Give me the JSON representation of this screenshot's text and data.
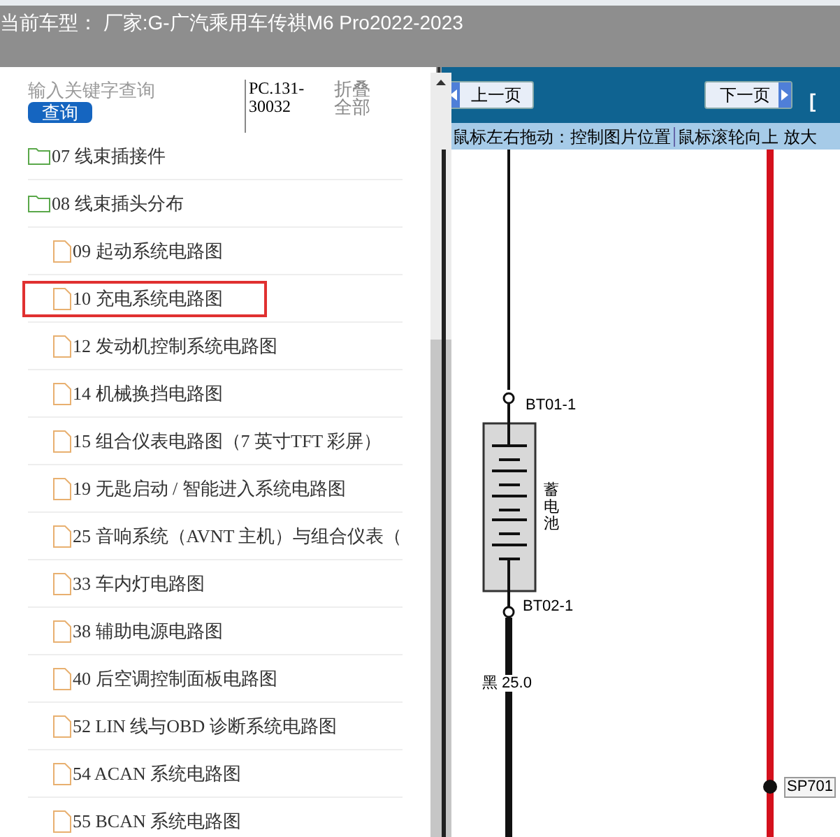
{
  "header": {
    "title": "当前车型：  厂家:G-广汽乘用车传祺M6 Pro2022-2023"
  },
  "search": {
    "placeholder": "输入关键字查询",
    "button": "查询",
    "code": "PC.131-30032",
    "collapse": "折叠全部"
  },
  "tree": [
    {
      "label": "07 线束插接件",
      "kind": "folder",
      "highlighted": false
    },
    {
      "label": "08 线束插头分布",
      "kind": "folder",
      "highlighted": false,
      "children": [
        {
          "label": "09 起动系统电路图",
          "kind": "file",
          "highlighted": false
        },
        {
          "label": "10 充电系统电路图",
          "kind": "file",
          "highlighted": true
        },
        {
          "label": "12 发动机控制系统电路图",
          "kind": "file",
          "highlighted": false
        },
        {
          "label": "14 机械换挡电路图",
          "kind": "file",
          "highlighted": false
        },
        {
          "label": "15 组合仪表电路图（7 英寸TFT 彩屏）",
          "kind": "file",
          "highlighted": false
        },
        {
          "label": "19 无匙启动 / 智能进入系统电路图",
          "kind": "file",
          "highlighted": false
        },
        {
          "label": "25 音响系统（AVNT 主机）与组合仪表（",
          "kind": "file",
          "highlighted": false
        },
        {
          "label": "33 车内灯电路图",
          "kind": "file",
          "highlighted": false
        },
        {
          "label": "38 辅助电源电路图",
          "kind": "file",
          "highlighted": false
        },
        {
          "label": "40 后空调控制面板电路图",
          "kind": "file",
          "highlighted": false
        },
        {
          "label": "52 LIN 线与OBD 诊断系统电路图",
          "kind": "file",
          "highlighted": false
        },
        {
          "label": "54 ACAN 系统电路图",
          "kind": "file",
          "highlighted": false
        },
        {
          "label": "55 BCAN 系统电路图",
          "kind": "file",
          "highlighted": false
        }
      ]
    }
  ],
  "toolbar": {
    "prev": "上一页",
    "next": "下一页",
    "bracket": "["
  },
  "hints": [
    "鼠标左右拖动：控制图片位置",
    "鼠标滚轮向上 放大"
  ],
  "diagram": {
    "top_pin": "BT01-1",
    "battery": "蓄电池",
    "bottom_pin": "BT02-1",
    "wire": "黑 25.0",
    "splice": "SP701"
  }
}
